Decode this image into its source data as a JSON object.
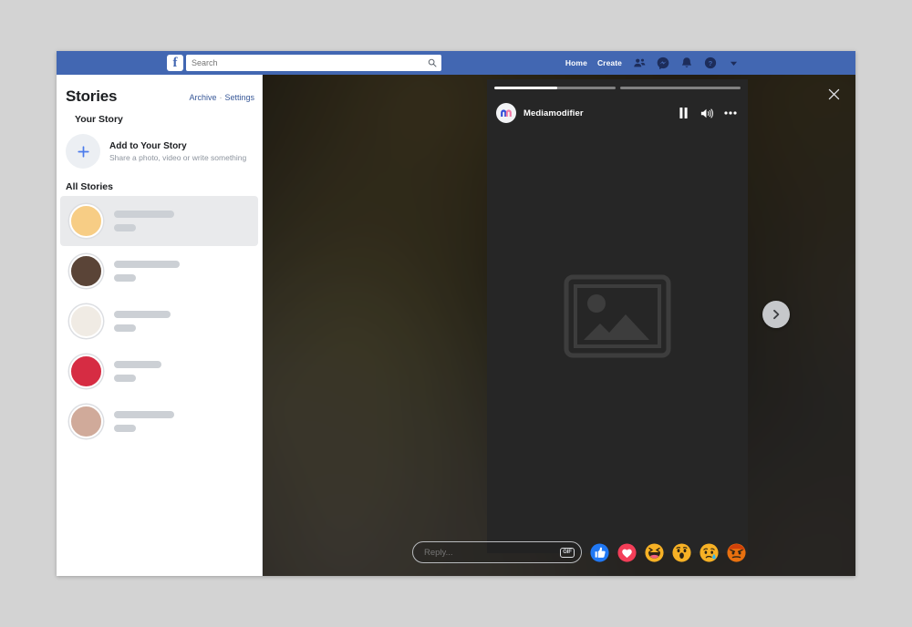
{
  "topbar": {
    "logo": "f",
    "logo_icon": "facebook-logo",
    "search": {
      "placeholder": "Search",
      "value": "",
      "icon": "search-icon"
    },
    "links": [
      {
        "label": "Home",
        "name": "nav-home"
      },
      {
        "label": "Create",
        "name": "nav-create"
      }
    ],
    "icons": [
      {
        "name": "friend-requests-icon"
      },
      {
        "name": "messenger-icon"
      },
      {
        "name": "notifications-icon"
      },
      {
        "name": "help-icon"
      },
      {
        "name": "account-chevron-down-icon"
      }
    ]
  },
  "sidebar": {
    "title": "Stories",
    "links": {
      "archive": "Archive",
      "separator": "·",
      "settings": "Settings"
    },
    "your_story_label": "Your Story",
    "add_story": {
      "title": "Add to Your Story",
      "subtitle": "Share a photo, video or write something",
      "icon": "plus-icon"
    },
    "all_stories_label": "All Stories",
    "stories": [
      {
        "avatar_color": "#f7cd85",
        "active": true,
        "line_width": 66
      },
      {
        "avatar_color": "#5a4437",
        "active": false,
        "line_width": 72
      },
      {
        "avatar_color": "#f0ebe4",
        "active": false,
        "line_width": 62
      },
      {
        "avatar_color": "#d62c43",
        "active": false,
        "line_width": 52
      },
      {
        "avatar_color": "#d0aa9a",
        "active": false,
        "line_width": 66
      }
    ]
  },
  "viewer": {
    "close_icon": "close-icon",
    "next_icon": "chevron-right-icon",
    "card": {
      "progress": [
        {
          "percent": 52
        },
        {
          "percent": 0
        }
      ],
      "brand_name": "Mediamodifier",
      "brand_avatar_icon": "mediamodifier-logo-icon",
      "controls": [
        {
          "name": "pause-button",
          "icon": "pause-icon"
        },
        {
          "name": "sound-button",
          "icon": "speaker-on-icon"
        },
        {
          "name": "more-options-button",
          "icon": "ellipsis-icon"
        }
      ],
      "placeholder_icon": "image-placeholder-icon"
    },
    "reply": {
      "placeholder": "Reply...",
      "value": "",
      "gif_label": "GIF"
    },
    "reactions": [
      {
        "name": "reaction-like",
        "label": "Like",
        "color": "#2078f4"
      },
      {
        "name": "reaction-love",
        "label": "Love",
        "color": "#f33e58"
      },
      {
        "name": "reaction-haha",
        "label": "Haha",
        "color": "#f7b125"
      },
      {
        "name": "reaction-wow",
        "label": "Wow",
        "color": "#f7b125"
      },
      {
        "name": "reaction-sad",
        "label": "Sad",
        "color": "#f7b125"
      },
      {
        "name": "reaction-angry",
        "label": "Angry",
        "color": "#e9710f"
      }
    ]
  },
  "colors": {
    "facebook_blue": "#4267b2",
    "link_blue": "#385898",
    "page_background": "#d3d3d3",
    "card_background": "#262626"
  }
}
